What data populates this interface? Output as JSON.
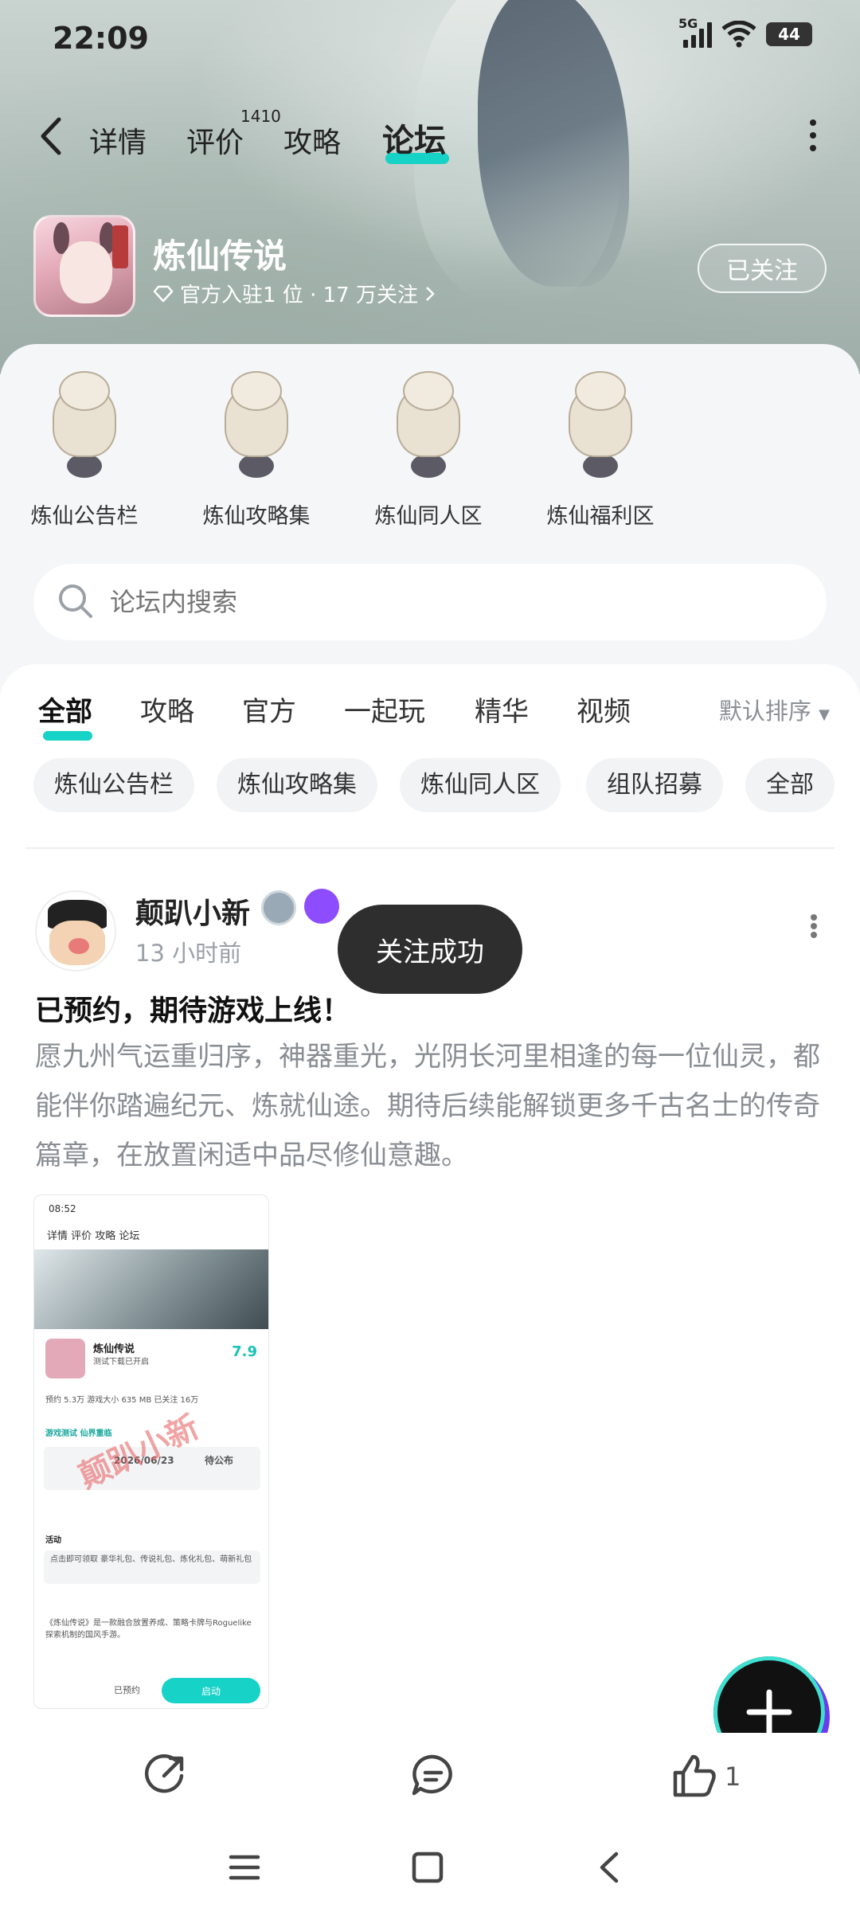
{
  "status": {
    "time": "22:09",
    "network": "5G",
    "battery": "44"
  },
  "nav": {
    "tabs": [
      {
        "label": "详情"
      },
      {
        "label": "评价",
        "badge": "1410"
      },
      {
        "label": "攻略"
      },
      {
        "label": "论坛",
        "active": true
      }
    ]
  },
  "game": {
    "title": "炼仙传说",
    "subtitle": "官方入驻1 位 · 17 万关注",
    "follow_label": "已关注"
  },
  "boards": [
    {
      "label": "炼仙公告栏"
    },
    {
      "label": "炼仙攻略集"
    },
    {
      "label": "炼仙同人区"
    },
    {
      "label": "炼仙福利区"
    }
  ],
  "search": {
    "placeholder": "论坛内搜索"
  },
  "feed": {
    "tabs": [
      "全部",
      "攻略",
      "官方",
      "一起玩",
      "精华",
      "视频"
    ],
    "active_tab": "全部",
    "sort_label": "默认排序",
    "chips": [
      "炼仙公告栏",
      "炼仙攻略集",
      "炼仙同人区",
      "组队招募",
      "全部"
    ]
  },
  "post": {
    "username": "颠趴小新",
    "time": "13 小时前",
    "title": "已预约，期待游戏上线！",
    "body": "愿九州气运重归序，神器重光，光阴长河里相逢的每一位仙灵，都能伴你踏遍纪元、炼就仙途。期待后续能解锁更多千古名士的传奇篇章，在放置闲适中品尽修仙意趣。",
    "image": {
      "status_time": "08:52",
      "tabs": "详情   评价   攻略   论坛",
      "name": "炼仙传说",
      "name_sub": "测试下载已开启",
      "score": "7.9",
      "stats": "预约 5.3万   游戏大小 635 MB   已关注 16万",
      "test_title": "游戏测试   仙界重临",
      "test_date": "2026/06/23",
      "test_status": "待公布",
      "activity": "活动",
      "activity_text": "点击即可领取 豪华礼包、传说礼包、炼化礼包、萌新礼包",
      "desc": "《炼仙传说》是一款融合放置养成、策略卡牌与Roguelike探索机制的国风手游。",
      "reserved": "已预约",
      "start": "启动",
      "watermark": "颠趴小新"
    },
    "likes": "1"
  },
  "toast": "关注成功",
  "colors": {
    "accent": "#17d2c6",
    "toast_bg": "#2e2e2e"
  }
}
